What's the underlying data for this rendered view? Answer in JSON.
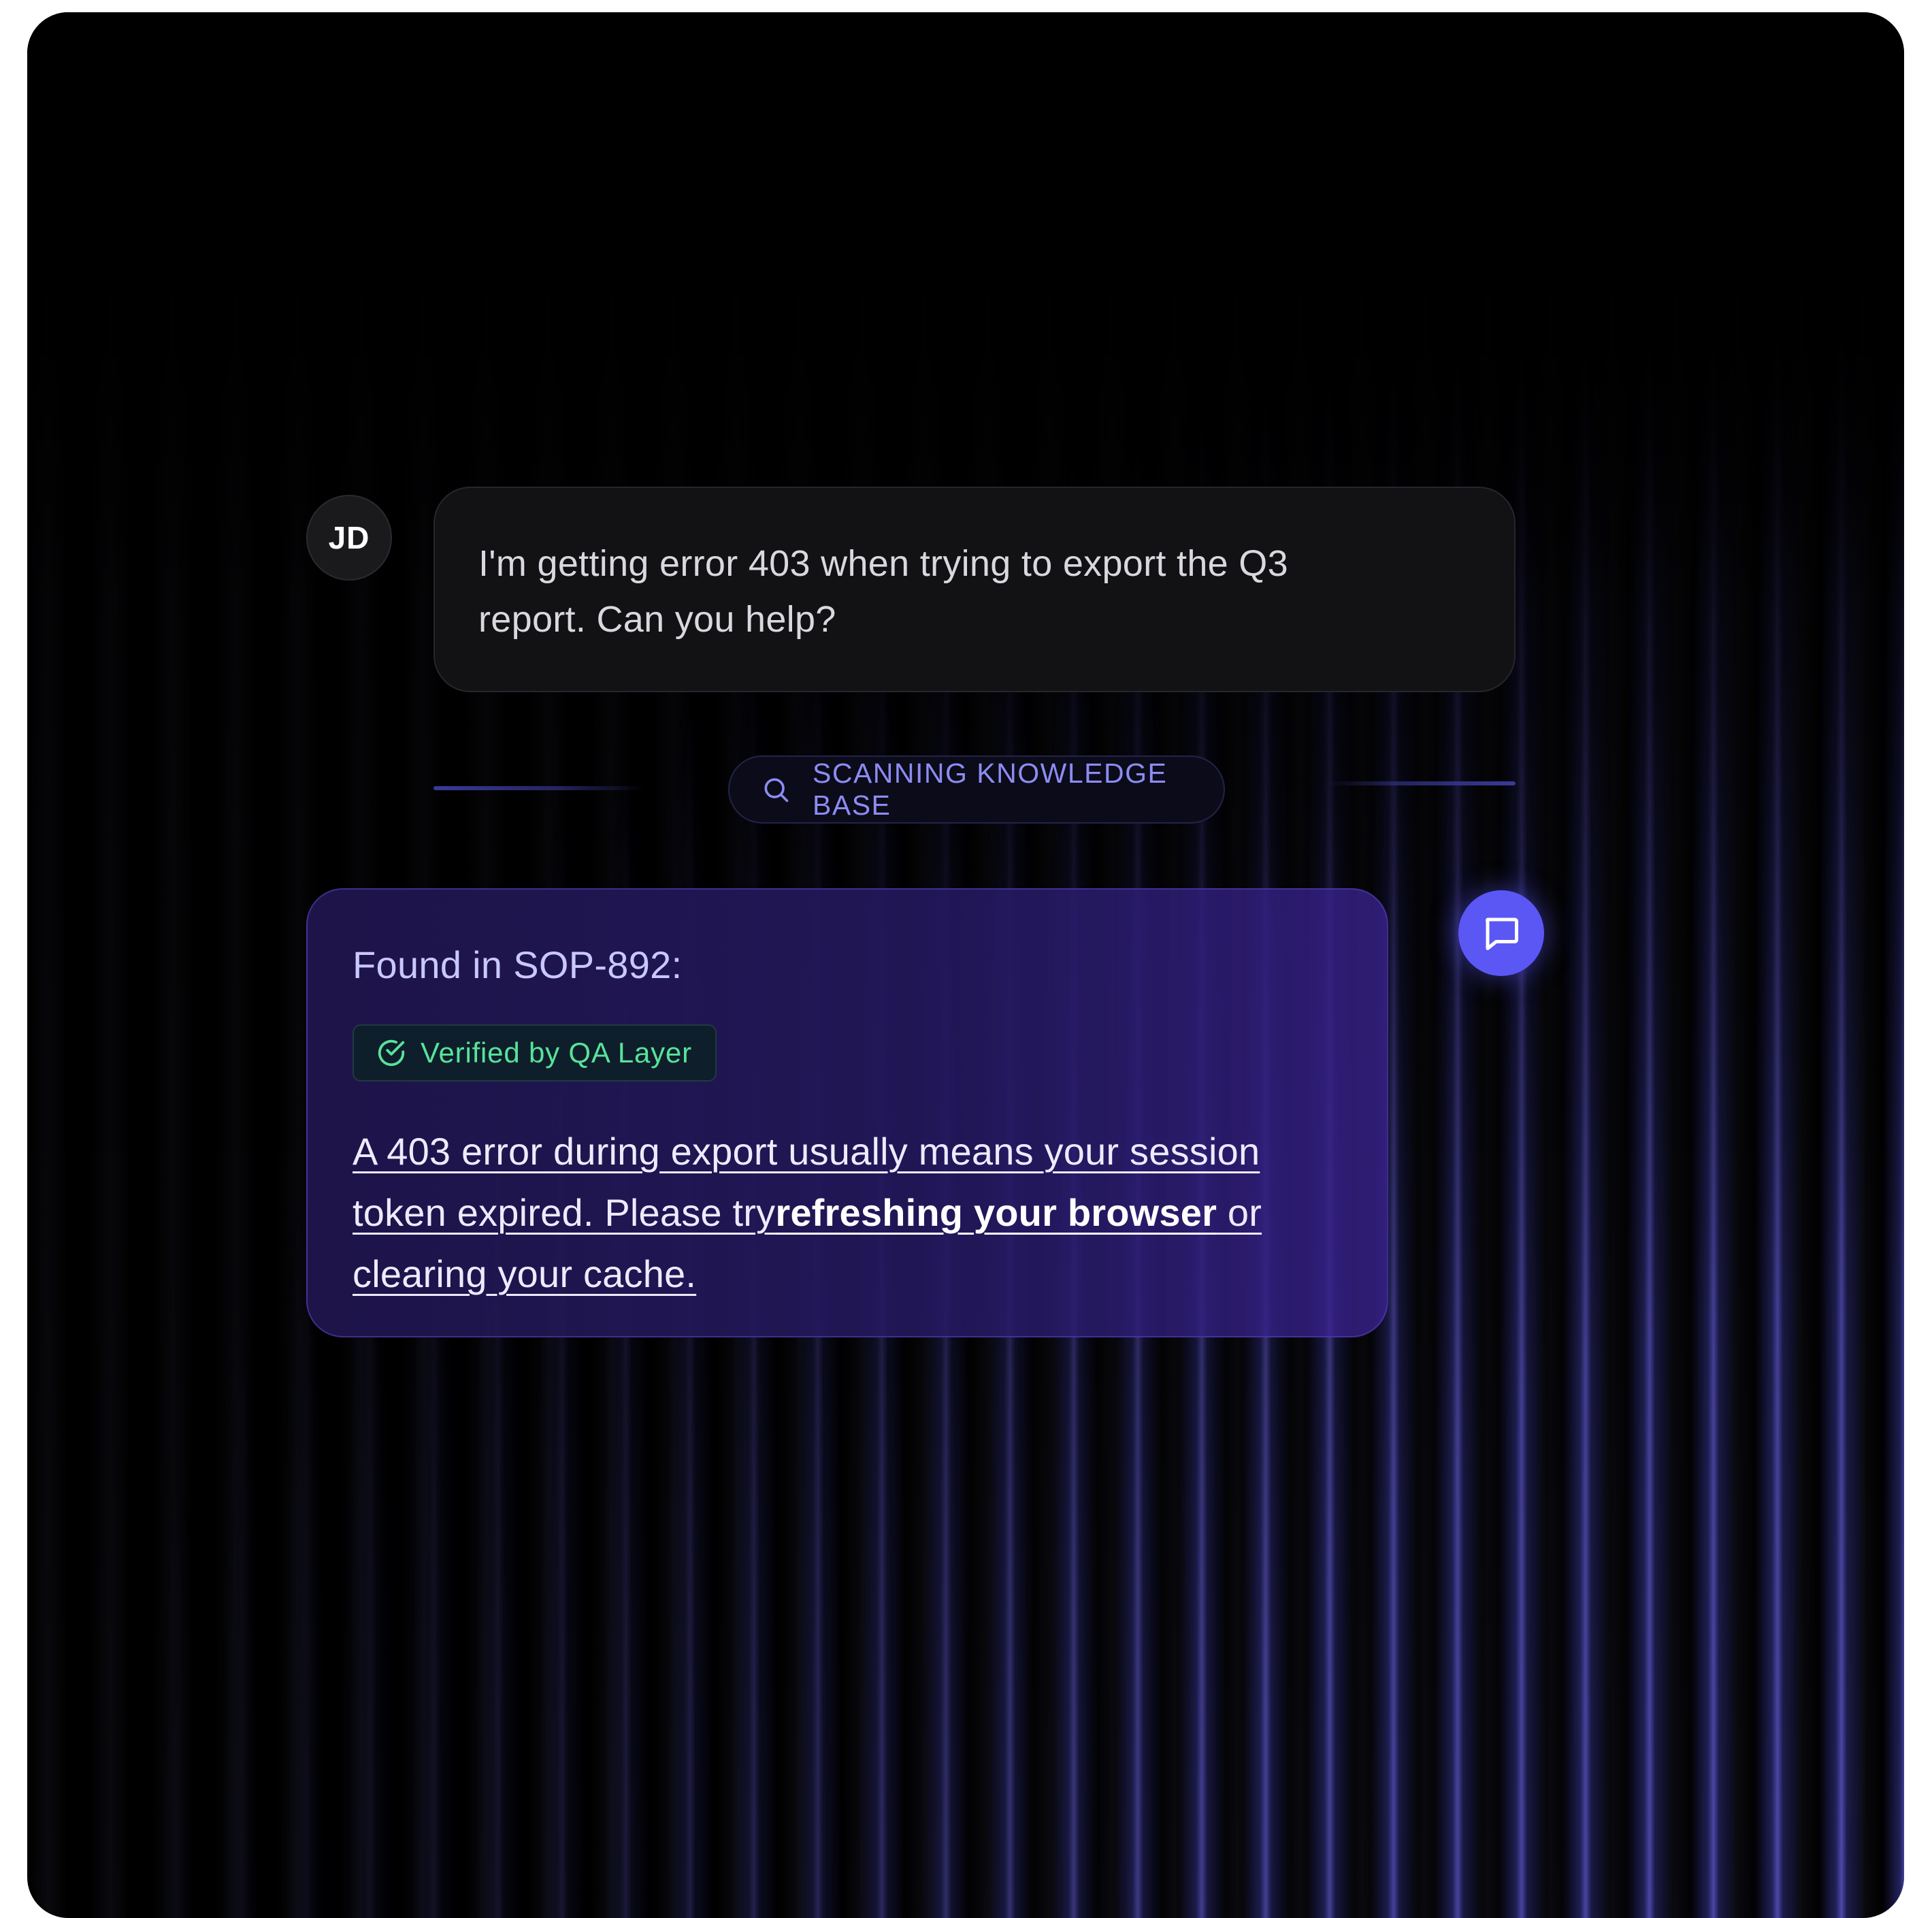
{
  "user_message": {
    "avatar_initials": "JD",
    "text": "I'm getting error 403 when trying to export the Q3 report. Can you help?"
  },
  "status": {
    "icon": "search-icon",
    "text": "SCANNING KNOWLEDGE BASE",
    "color": "#8c8cf2"
  },
  "bot_message": {
    "title": "Found in SOP-892:",
    "badge": {
      "icon": "check-circle-icon",
      "text": "Verified by QA Layer",
      "color": "#57e39a"
    },
    "answer_part1": "A 403 error during export usually means your session token expired. Please try",
    "answer_bold": "refreshing your browser",
    "answer_part2": " or",
    "answer_part3": "clearing your cache.",
    "avatar_icon": "chat-bubble-icon"
  },
  "colors": {
    "background": "#000000",
    "accent": "#5b57f5",
    "user_bubble": "#121215",
    "bot_bubble": "#261a64"
  }
}
